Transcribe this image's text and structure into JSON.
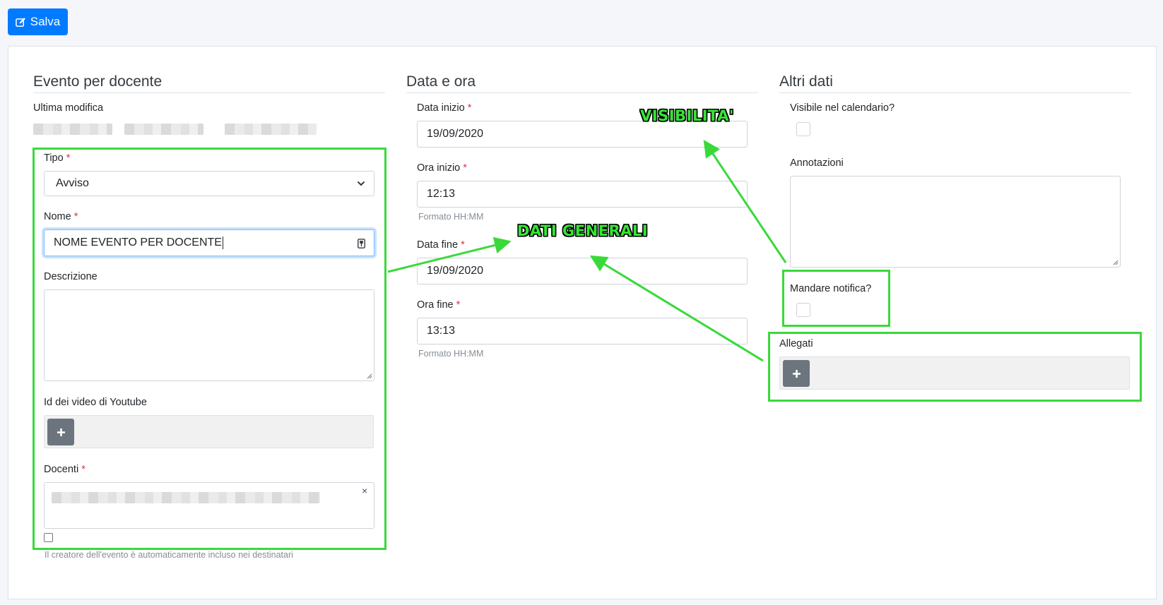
{
  "toolbar": {
    "save_label": "Salva",
    "save_icon": "edit-icon"
  },
  "sections": {
    "general": {
      "title": "Evento per docente"
    },
    "datetime": {
      "title": "Data e ora"
    },
    "other": {
      "title": "Altri dati"
    }
  },
  "general": {
    "last_modified_label": "Ultima modifica",
    "type_label": "Tipo",
    "type_value": "Avviso",
    "name_label": "Nome",
    "name_value": "NOME EVENTO PER DOCENTE",
    "description_label": "Descrizione",
    "youtube_label": "Id dei video di Youtube",
    "teachers_label": "Docenti",
    "teachers_clear": "×",
    "creator_note": "Il creatore dell'evento è automaticamente incluso nei destinatari"
  },
  "datetime": {
    "start_date_label": "Data inizio",
    "start_date_value": "19/09/2020",
    "start_time_label": "Ora inizio",
    "start_time_value": "12:13",
    "start_time_help": "Formato HH:MM",
    "end_date_label": "Data fine",
    "end_date_value": "19/09/2020",
    "end_time_label": "Ora fine",
    "end_time_value": "13:13",
    "end_time_help": "Formato HH:MM"
  },
  "other": {
    "visible_label": "Visibile nel calendario?",
    "notes_label": "Annotazioni",
    "notify_label": "Mandare notifica?",
    "attachments_label": "Allegati"
  },
  "required_marker": "*",
  "annotations": {
    "visibility": "VISIBILITA'",
    "general_data": "DATI GENERALI",
    "color": "#39d93a"
  },
  "colors": {
    "primary": "#007bff",
    "secondary": "#6c757d",
    "required": "#dc3545",
    "highlight": "#39d93a"
  }
}
